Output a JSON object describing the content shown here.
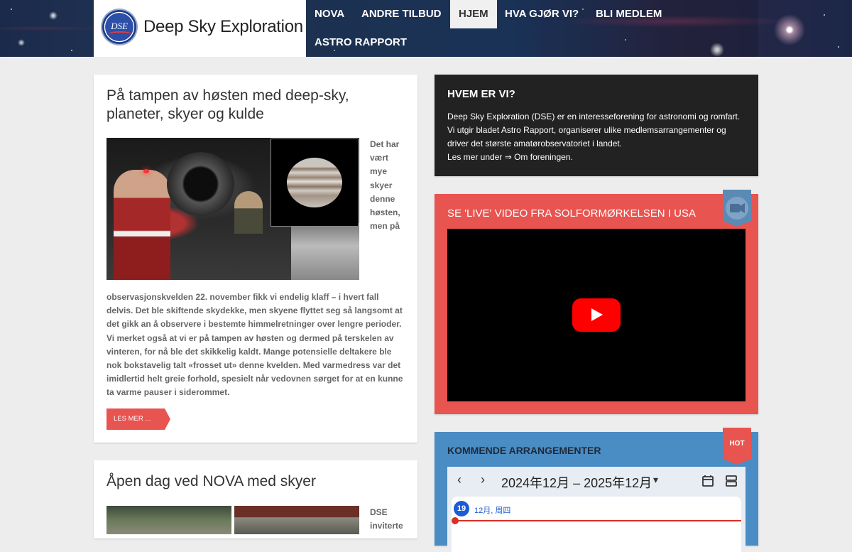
{
  "header": {
    "logo_text": "Deep Sky Exploration",
    "logo_emblem_text": "DSE",
    "nav": [
      {
        "label": "NOVA",
        "active": false
      },
      {
        "label": "ANDRE TILBUD",
        "active": false
      },
      {
        "label": "HJEM",
        "active": true
      },
      {
        "label": "HVA GJØR VI?",
        "active": false
      },
      {
        "label": "BLI MEDLEM",
        "active": false
      },
      {
        "label": "ASTRO RAPPORT",
        "active": false
      }
    ]
  },
  "posts": [
    {
      "title": "På tampen av høsten med deep-sky, planeter, skyer og kulde",
      "side_text": "Det har vært mye skyer denne høsten, men på",
      "body": "observasjonskvelden 22. november fikk vi endelig klaff – i hvert fall delvis. Det ble skiftende skydekke, men skyene flyttet seg så langsomt at det gikk an å observere i bestemte himmelretninger over lengre perioder. Vi merket også at vi er på tampen av høsten og dermed på terskelen av vinteren, for nå ble det skikkelig kaldt. Mange potensielle deltakere ble nok bokstavelig talt «frosset ut» denne kvelden. Med varmedress var det imidlertid helt greie forhold, spesielt når vedovnen sørget for at en kunne ta varme pauser i siderommet.",
      "read_more": "LES MER ..."
    },
    {
      "title": "Åpen dag ved NOVA med skyer",
      "side_text": "DSE invitertе"
    }
  ],
  "widgets": {
    "about": {
      "title": "HVEM ER VI?",
      "line1": "Deep Sky Exploration (DSE) er en interesseforening for astronomi og romfart.",
      "line2": "Vi utgir bladet Astro Rapport, organiserer ulike medlemsarrangementer og",
      "line3": "driver det største amatørobservatoriet i landet.",
      "line4": "Les mer under ⇒ Om foreningen."
    },
    "video": {
      "title": "SE 'LIVE' VIDEO FRA SOLFORMØRKELSEN I USA",
      "ribbon_icon": "video-camera-icon"
    },
    "events": {
      "title": "KOMMENDE ARRANGEMENTER",
      "ribbon_label": "HOT",
      "prev": "‹",
      "next": "›",
      "range": "2024年12月 – 2025年12月",
      "dropdown": "▾",
      "day_number": "19",
      "day_label": "12月, 周四"
    }
  },
  "colors": {
    "accent_red": "#e85450",
    "dark": "#222222",
    "blue": "#4a8cc4",
    "ribbon_blue": "#5b8ab5",
    "youtube_red": "#ff0000"
  }
}
